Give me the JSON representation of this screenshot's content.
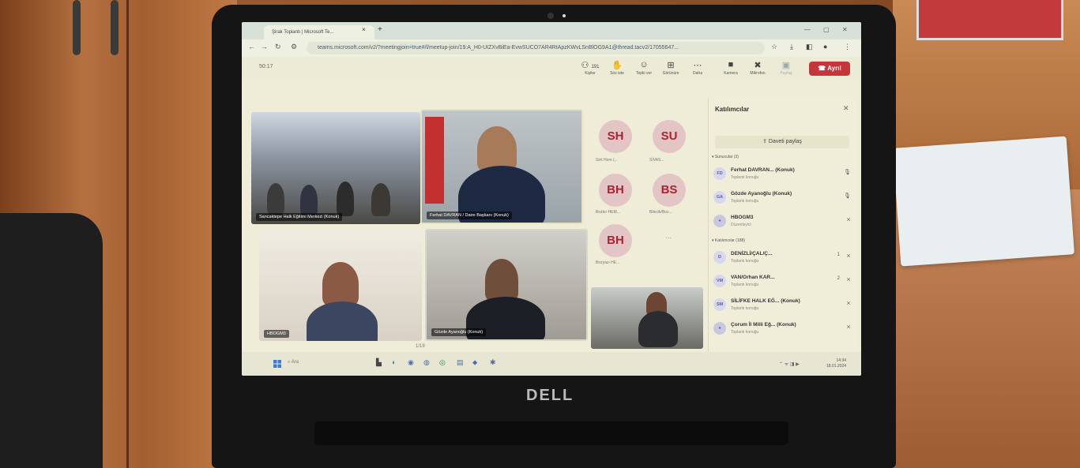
{
  "browser": {
    "tab_title": "Şirak Toplantı | Microsoft Te...",
    "new_tab": "+",
    "tab_close": "×",
    "url": "teams.microsoft.com/v2/?meetingjoin=true#/l/meetup-join/19:A_H0-UIZXvBiEa-EvwSUCO7AR4RtApzKWvLSnBlOG9A1@thread.tacv2/17055647..."
  },
  "toolbar": {
    "timer": "50:17",
    "people_count": "191",
    "people_label": "Kişiler",
    "raise_label": "Söz iste",
    "react_label": "Tepki ver",
    "view_label": "Görünüm",
    "more_label": "Daha",
    "camera_label": "Kamera",
    "mic_label": "Mikrofon",
    "share_label": "Paylaş",
    "leave_label": "Ayrıl"
  },
  "videos": [
    {
      "name": "Sancaktepe Halk Eğitimi Merkezi (Konuk)"
    },
    {
      "name": "Ferhat DAVRAN / Daire Başkanı (Konuk)"
    },
    {
      "name": "HBOGM3"
    },
    {
      "name": "Gözde Ayanoğlu (Konuk)"
    }
  ],
  "pager": "1/19",
  "avatars": [
    {
      "initials": "SH",
      "label": "Siirt Hem (..."
    },
    {
      "initials": "SU",
      "label": "SİVAS..."
    },
    {
      "initials": "BH",
      "label": "Bozkır HEM..."
    },
    {
      "initials": "BS",
      "label": "Bilecik/Boz..."
    },
    {
      "initials": "BH",
      "label": "Bozyazı HE..."
    }
  ],
  "avatar_more": "...",
  "participants": {
    "title": "Katılımcılar",
    "invite": "Daveti paylaş",
    "presenters_header": "Sunucular (3)",
    "attendees_header": "Katılımcılar (188)",
    "presenters": [
      {
        "initials": "FD",
        "name": "Ferhat DAVRAN... (Konuk)",
        "role": "Toplantı konuğu"
      },
      {
        "initials": "GA",
        "name": "Gözde Ayanoğlu (Konuk)",
        "role": "Toplantı konuğu"
      },
      {
        "initials": "",
        "name": "HBOGM3",
        "role": "Düzenleyici"
      }
    ],
    "attendees": [
      {
        "initials": "D",
        "name": "DENİZLİ/ÇAL/Ç...",
        "role": "Toplantı konuğu",
        "count": "1"
      },
      {
        "initials": "VM",
        "name": "VAN/Orhan KAR...",
        "role": "Toplantı konuğu",
        "count": "2"
      },
      {
        "initials": "SM",
        "name": "SİLİFKE HALK EĞ... (Konuk)",
        "role": "Toplantı konuğu",
        "count": ""
      },
      {
        "initials": "",
        "name": "Çorum İl Milli Eğ... (Konuk)",
        "role": "Toplantı konuğu",
        "count": ""
      }
    ]
  },
  "taskbar": {
    "search": "Ara",
    "time": "14:34",
    "date": "18.01.2024"
  },
  "laptop_brand": "DELL",
  "colors": {
    "leave": "#c5363a",
    "avatar_bg": "#e3c5c5",
    "avatar_text": "#a22233"
  }
}
